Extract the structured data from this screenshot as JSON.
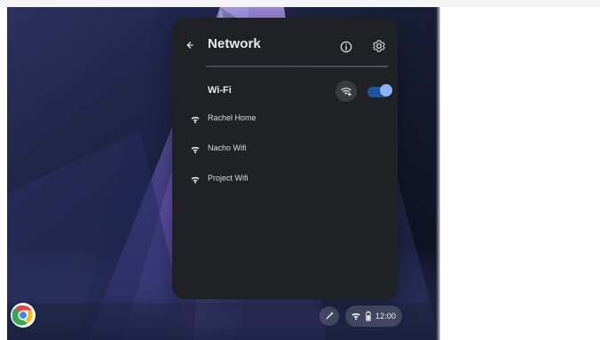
{
  "network_panel": {
    "title": "Network",
    "wifi_label": "Wi-Fi",
    "wifi_enabled": true,
    "networks": [
      {
        "name": "Rachel Home"
      },
      {
        "name": "Nacho Wifi"
      },
      {
        "name": "Project Wifi"
      }
    ]
  },
  "shelf": {
    "time": "12:00"
  },
  "icons": {
    "back": "arrow-left-icon",
    "info": "info-icon",
    "settings": "gear-icon",
    "wifi_add": "wifi-add-icon",
    "wifi": "wifi-icon",
    "launcher": "chrome-icon",
    "pen": "pen-icon",
    "battery": "battery-icon"
  },
  "colors": {
    "panel_bg": "#202124",
    "accent": "#8AB4F8",
    "toggle_track": "#1A73E8"
  }
}
